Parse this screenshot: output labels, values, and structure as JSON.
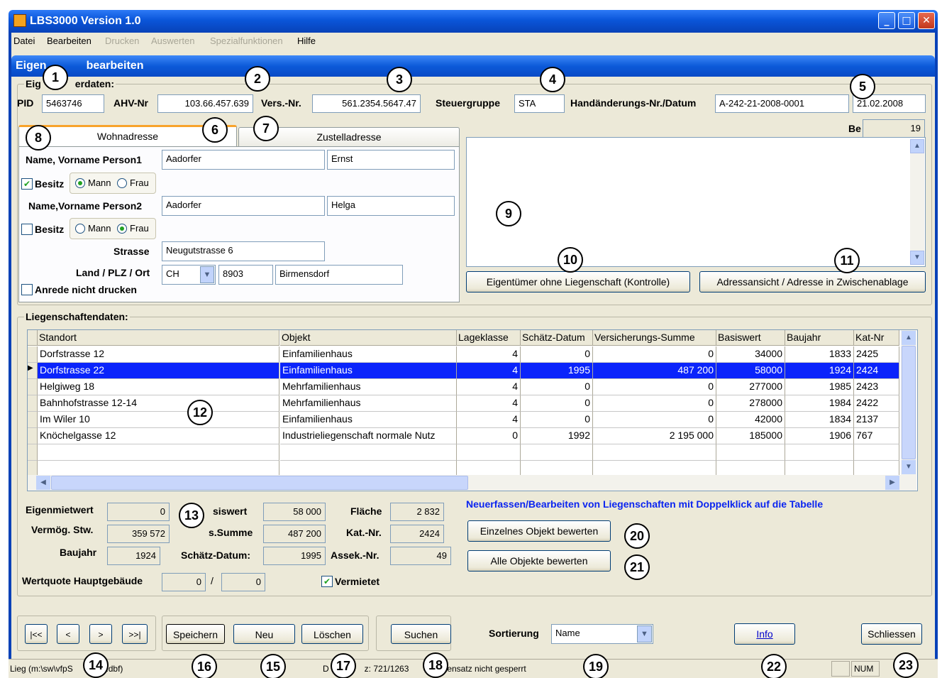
{
  "window": {
    "title": "LBS3000 Version 1.0",
    "minimize": "_",
    "maximize": "□",
    "close": "✕",
    "icon": "house-icon"
  },
  "menu": [
    {
      "label": "Datei",
      "enabled": true
    },
    {
      "label": "Bearbeiten",
      "enabled": true
    },
    {
      "label": "Drucken",
      "enabled": false
    },
    {
      "label": "Auswerten",
      "enabled": false
    },
    {
      "label": "Spezialfunktionen",
      "enabled": false
    },
    {
      "label": "Hilfe",
      "enabled": true
    }
  ],
  "form_title": "Eigen",
  "form_title_tail": "bearbeiten",
  "owner": {
    "group_label_start": "Eig",
    "group_label_end": "erdaten:",
    "pid_label": "PID",
    "pid": "5463746",
    "ahv_label": "AHV-Nr",
    "ahv": "103.66.457.639",
    "vers_label": "Vers.-Nr.",
    "vers": "561.2354.5647.47",
    "steuer_label": "Steuergruppe",
    "steuer": "STA",
    "hand_label": "Handänderungs-Nr./Datum",
    "hand_nr": "A-242-21-2008-0001",
    "hand_datum": "21.02.2008",
    "be_label": "Be",
    "be_value": "19"
  },
  "tabs": {
    "wohn": "Wohnadresse",
    "zustell": "Zustelladresse"
  },
  "address": {
    "person1_label": "Name, Vorname Person1",
    "p1_name": "Aadorfer",
    "p1_vorname": "Ernst",
    "person2_label": "Name,Vorname Person2",
    "p2_name": "Aadorfer",
    "p2_vorname": "Helga",
    "besitz_label": "Besitz",
    "mann_label": "Mann",
    "frau_label": "Frau",
    "p1_besitz": true,
    "p1_sex": "Mann",
    "p2_besitz": false,
    "p2_sex": "Frau",
    "strasse_label": "Strasse",
    "strasse": "Neugutstrasse 6",
    "land_label": "Land / PLZ / Ort",
    "land": "CH",
    "plz": "8903",
    "ort": "Birmensdorf",
    "anrede_label": "Anrede nicht drucken"
  },
  "buttons": {
    "eig_ohne": "Eigentümer ohne Liegenschaft (Kontrolle)",
    "adressansicht": "Adressansicht / Adresse in Zwischenablage",
    "einzeln": "Einzelnes Objekt bewerten",
    "alle": "Alle Objekte bewerten",
    "first": "|<<",
    "prev": "<",
    "next": ">",
    "last": ">>|",
    "speichern": "Speichern",
    "neu": "Neu",
    "loeschen": "Löschen",
    "suchen": "Suchen",
    "info": "Info",
    "schliessen": "Schliessen"
  },
  "liegenschaften": {
    "label": "Liegenschaftendaten:",
    "columns": [
      "Standort",
      "Objekt",
      "Lageklasse",
      "Schätz-Datum",
      "Versicherungs-Summe",
      "Basiswert",
      "Baujahr",
      "Kat-Nr"
    ],
    "rows": [
      [
        "Dorfstrasse  12",
        "Einfamilienhaus",
        "4",
        "0",
        "0",
        "34000",
        "1833",
        "2425"
      ],
      [
        "Dorfstrasse  22",
        "Einfamilienhaus",
        "4",
        "1995",
        "487 200",
        "58000",
        "1924",
        "2424"
      ],
      [
        "Helgiweg 18",
        "Mehrfamilienhaus",
        "4",
        "0",
        "0",
        "277000",
        "1985",
        "2423"
      ],
      [
        "Bahnhofstrasse 12-14",
        "Mehrfamilienhaus",
        "4",
        "0",
        "0",
        "278000",
        "1984",
        "2422"
      ],
      [
        "Im Wiler 10",
        "Einfamilienhaus",
        "4",
        "0",
        "0",
        "42000",
        "1834",
        "2137"
      ],
      [
        "Knöchelgasse 12",
        "Industrieliegenschaft normale Nutz",
        "0",
        "1992",
        "2 195 000",
        "185000",
        "1906",
        "767"
      ]
    ],
    "selected_row": 1,
    "hint": "Neuerfassen/Bearbeiten von Liegenschaften mit Doppelklick auf die Tabelle"
  },
  "details": {
    "eigenmietwert_label": "Eigenmietwert",
    "eigenmietwert": "0",
    "basiswert_label_tail": "siswert",
    "basiswert": "58 000",
    "flaeche_label": "Fläche",
    "flaeche": "2 832",
    "vermoeg_label": "Vermög. Stw.",
    "vermoeg": "359 572",
    "verssumme_label_tail": "s.Summe",
    "verssumme": "487 200",
    "katnr_label": "Kat.-Nr.",
    "katnr": "2424",
    "baujahr_label": "Baujahr",
    "baujahr": "1924",
    "schaetz_label": "Schätz-Datum:",
    "schaetz": "1995",
    "assek_label": "Assek.-Nr.",
    "assek": "49",
    "wertquote_label": "Wertquote Hauptgebäude",
    "wertquote1": "0",
    "wertquote_sep": "/",
    "wertquote2": "0",
    "vermietet_label": "Vermietet"
  },
  "sort": {
    "label": "Sortierung",
    "value": "Name"
  },
  "status": {
    "path_start": "Lieg (m:\\sw\\vfpS",
    "path_end": "0\\lieg.dbf)",
    "record_pre": "D",
    "record": "z: 721/1263",
    "lock": "tensatz nicht gesperrt",
    "num": "NUM"
  },
  "callouts": [
    "1",
    "2",
    "3",
    "4",
    "5",
    "6",
    "7",
    "8",
    "9",
    "10",
    "11",
    "12",
    "13",
    "14",
    "15",
    "16",
    "17",
    "18",
    "19",
    "20",
    "21",
    "22",
    "23"
  ]
}
